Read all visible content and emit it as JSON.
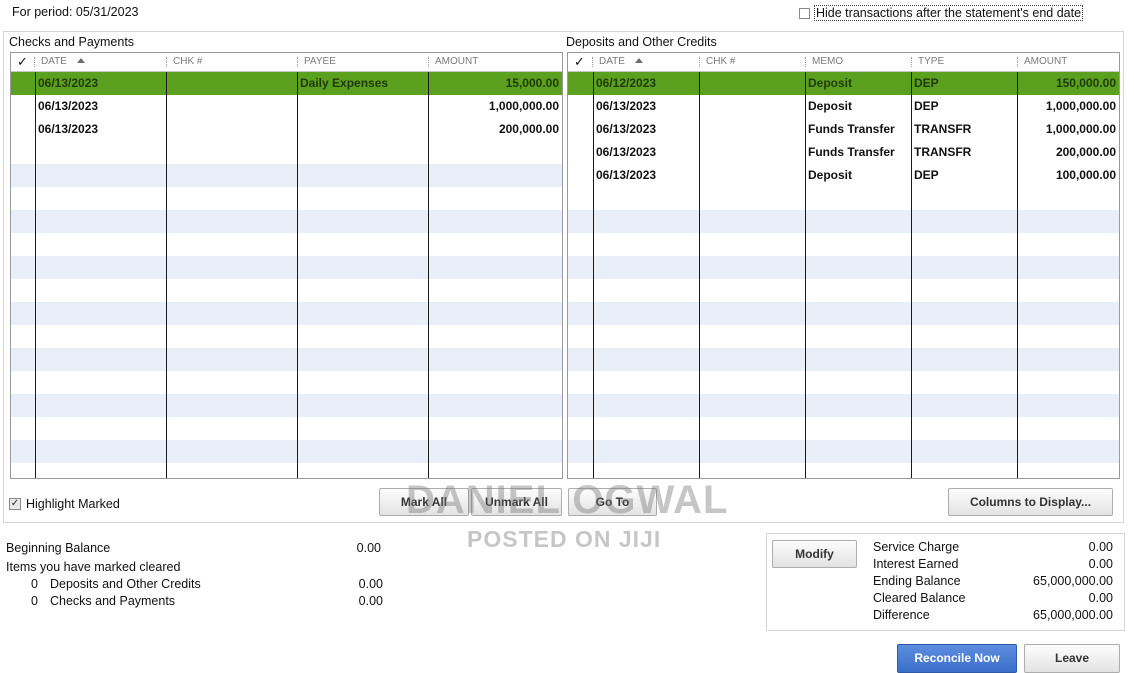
{
  "period_label": "For period: 05/31/2023",
  "hide_transactions_label": "Hide transactions after the statement's end date",
  "checks": {
    "title": "Checks and Payments",
    "headers": {
      "check": "✓",
      "date": "DATE",
      "chk": "CHK #",
      "payee": "PAYEE",
      "amount": "AMOUNT"
    },
    "rows": [
      {
        "date": "06/13/2023",
        "chk": "",
        "payee": "Daily Expenses",
        "amount": "15,000.00"
      },
      {
        "date": "06/13/2023",
        "chk": "",
        "payee": "",
        "amount": "1,000,000.00"
      },
      {
        "date": "06/13/2023",
        "chk": "",
        "payee": "",
        "amount": "200,000.00"
      }
    ]
  },
  "deposits": {
    "title": "Deposits and Other Credits",
    "headers": {
      "check": "✓",
      "date": "DATE",
      "chk": "CHK #",
      "memo": "MEMO",
      "type": "TYPE",
      "amount": "AMOUNT"
    },
    "rows": [
      {
        "date": "06/12/2023",
        "chk": "",
        "memo": "Deposit",
        "type": "DEP",
        "amount": "150,000.00"
      },
      {
        "date": "06/13/2023",
        "chk": "",
        "memo": "Deposit",
        "type": "DEP",
        "amount": "1,000,000.00"
      },
      {
        "date": "06/13/2023",
        "chk": "",
        "memo": "Funds Transfer",
        "type": "TRANSFR",
        "amount": "1,000,000.00"
      },
      {
        "date": "06/13/2023",
        "chk": "",
        "memo": "Funds Transfer",
        "type": "TRANSFR",
        "amount": "200,000.00"
      },
      {
        "date": "06/13/2023",
        "chk": "",
        "memo": "Deposit",
        "type": "DEP",
        "amount": "100,000.00"
      }
    ]
  },
  "highlight_marked_label": "Highlight Marked",
  "buttons": {
    "mark_all": "Mark All",
    "unmark_all": "Unmark All",
    "go_to": "Go To",
    "columns": "Columns to Display...",
    "modify": "Modify",
    "reconcile_now": "Reconcile Now",
    "leave": "Leave"
  },
  "summary": {
    "beginning_balance_label": "Beginning Balance",
    "beginning_balance_value": "0.00",
    "items_marked_label": "Items you have marked cleared",
    "deposits_count": "0",
    "deposits_label": "Deposits and Other Credits",
    "deposits_value": "0.00",
    "checks_count": "0",
    "checks_label": "Checks and Payments",
    "checks_value": "0.00"
  },
  "totals": [
    {
      "label": "Service Charge",
      "value": "0.00"
    },
    {
      "label": "Interest Earned",
      "value": "0.00"
    },
    {
      "label": "Ending Balance",
      "value": "65,000,000.00"
    },
    {
      "label": "Cleared Balance",
      "value": "0.00"
    },
    {
      "label": "Difference",
      "value": "65,000,000.00"
    }
  ],
  "watermark": {
    "line1": "DANIEL OGWAL",
    "line2": "POSTED ON JIJI"
  },
  "icons": {
    "sort": "sort-ascending-icon",
    "check": "check-mark-icon"
  },
  "colors": {
    "selected_row": "#5ba01e",
    "alt_row": "#e9eff9",
    "primary_button": "#3b6fc8"
  }
}
